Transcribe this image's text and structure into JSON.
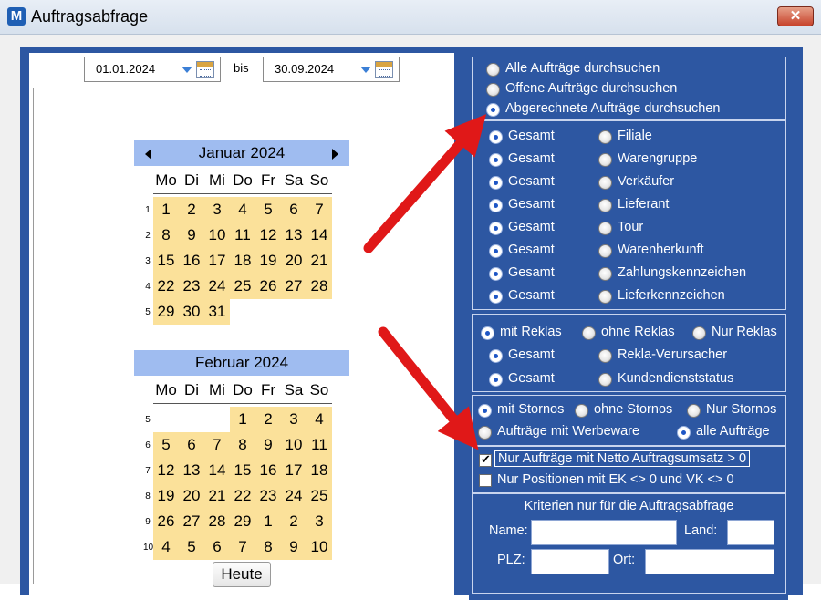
{
  "window": {
    "title": "Auftragsabfrage",
    "app_icon_letter": "M",
    "close_symbol": "✕"
  },
  "date_range": {
    "from": "01.01.2024",
    "separator": "bis",
    "to": "30.09.2024"
  },
  "calendar": {
    "weekday_labels": [
      "Mo",
      "Di",
      "Mi",
      "Do",
      "Fr",
      "Sa",
      "So"
    ],
    "months": [
      {
        "title": "Januar 2024",
        "weeks": [
          {
            "num": "1",
            "days": [
              "1",
              "2",
              "3",
              "4",
              "5",
              "6",
              "7"
            ]
          },
          {
            "num": "2",
            "days": [
              "8",
              "9",
              "10",
              "11",
              "12",
              "13",
              "14"
            ]
          },
          {
            "num": "3",
            "days": [
              "15",
              "16",
              "17",
              "18",
              "19",
              "20",
              "21"
            ]
          },
          {
            "num": "4",
            "days": [
              "22",
              "23",
              "24",
              "25",
              "26",
              "27",
              "28"
            ]
          },
          {
            "num": "5",
            "days": [
              "29",
              "30",
              "31",
              "",
              "",
              "",
              ""
            ]
          }
        ]
      },
      {
        "title": "Februar 2024",
        "weeks": [
          {
            "num": "5",
            "days": [
              "",
              "",
              "",
              "1",
              "2",
              "3",
              "4"
            ]
          },
          {
            "num": "6",
            "days": [
              "5",
              "6",
              "7",
              "8",
              "9",
              "10",
              "11"
            ]
          },
          {
            "num": "7",
            "days": [
              "12",
              "13",
              "14",
              "15",
              "16",
              "17",
              "18"
            ]
          },
          {
            "num": "8",
            "days": [
              "19",
              "20",
              "21",
              "22",
              "23",
              "24",
              "25"
            ]
          },
          {
            "num": "9",
            "days": [
              "26",
              "27",
              "28",
              "29",
              "1",
              "2",
              "3"
            ]
          },
          {
            "num": "10",
            "days": [
              "4",
              "5",
              "6",
              "7",
              "8",
              "9",
              "10"
            ]
          }
        ]
      }
    ],
    "today_button": "Heute"
  },
  "search_scope": {
    "options": [
      {
        "label": "Alle Aufträge durchsuchen",
        "selected": false
      },
      {
        "label": "Offene Aufträge durchsuchen",
        "selected": false
      },
      {
        "label": "Abgerechnete Aufträge durchsuchen",
        "selected": true
      }
    ]
  },
  "filters": {
    "rows": [
      {
        "left": "Gesamt",
        "right": "Filiale"
      },
      {
        "left": "Gesamt",
        "right": "Warengruppe"
      },
      {
        "left": "Gesamt",
        "right": "Verkäufer"
      },
      {
        "left": "Gesamt",
        "right": "Lieferant"
      },
      {
        "left": "Gesamt",
        "right": "Tour"
      },
      {
        "left": "Gesamt",
        "right": "Warenherkunft"
      },
      {
        "left": "Gesamt",
        "right": "Zahlungskennzeichen"
      },
      {
        "left": "Gesamt",
        "right": "Lieferkennzeichen"
      }
    ]
  },
  "reklas": {
    "mode": [
      "mit Reklas",
      "ohne Reklas",
      "Nur Reklas"
    ],
    "rows": [
      {
        "left": "Gesamt",
        "right": "Rekla-Verursacher"
      },
      {
        "left": "Gesamt",
        "right": "Kundendienststatus"
      }
    ]
  },
  "stornos": {
    "mode": [
      "mit Stornos",
      "ohne Stornos",
      "Nur Stornos"
    ],
    "werbe": [
      "Aufträge mit Werbeware",
      "alle Aufträge"
    ]
  },
  "checkboxes": [
    {
      "label": "Nur Aufträge mit Netto Auftragsumsatz > 0",
      "checked": true
    },
    {
      "label": "Nur Positionen mit EK <> 0 und VK <> 0",
      "checked": false
    }
  ],
  "criteria": {
    "title": "Kriterien nur für die Auftragsabfrage",
    "name_label": "Name:",
    "land_label": "Land:",
    "plz_label": "PLZ:",
    "ort_label": "Ort:"
  },
  "colors": {
    "panel_blue": "#2d57a2",
    "calendar_highlight": "#fbe19a",
    "month_header": "#9fbcf0",
    "arrow_red": "#e01818"
  }
}
